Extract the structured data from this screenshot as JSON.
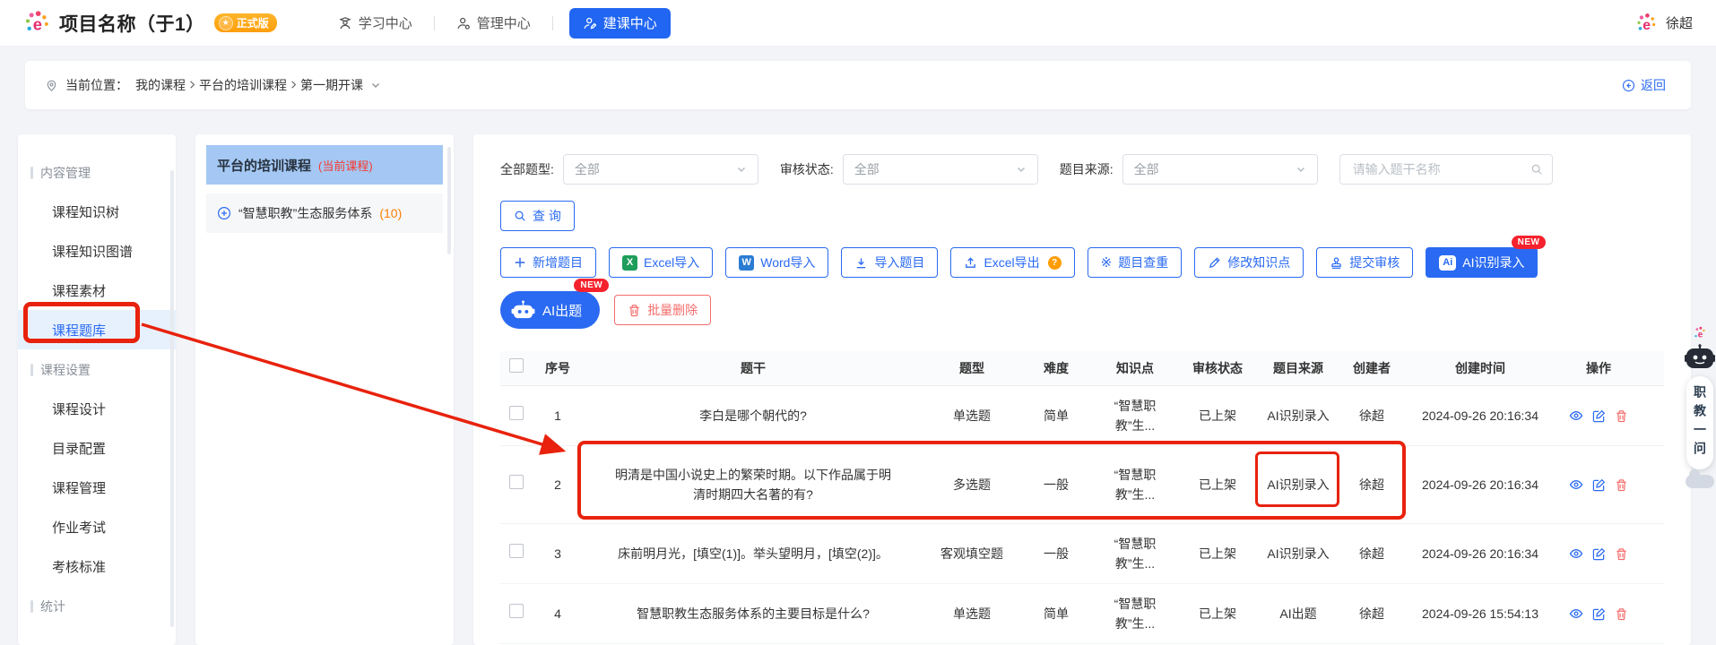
{
  "colors": {
    "accent": "#2a6af2",
    "danger": "#f56c6c",
    "annotation": "#e8220d",
    "badge_orange": "#ff9e0a",
    "count_orange": "#ff7d00",
    "tag_red": "#f5392f",
    "course_highlight": "#a4c8f3"
  },
  "header": {
    "title": "项目名称（于1）",
    "version_badge": "正式版",
    "nav": [
      {
        "id": "learning-center",
        "label": "学习中心",
        "icon": "person-study",
        "active": false
      },
      {
        "id": "admin-center",
        "label": "管理中心",
        "icon": "person-gear",
        "active": false
      },
      {
        "id": "course-building-center",
        "label": "建课中心",
        "icon": "person-edit",
        "active": true
      }
    ],
    "user_name": "徐超"
  },
  "breadcrumb": {
    "prefix": "当前位置：",
    "items": [
      "我的课程",
      "平台的培训课程",
      "第一期开课"
    ],
    "back_label": "返回"
  },
  "sidebar": {
    "sections": [
      {
        "id": "content-management",
        "title": "内容管理",
        "items": [
          {
            "id": "course-knowledge-tree",
            "label": "课程知识树",
            "active": false
          },
          {
            "id": "course-knowledge-graph",
            "label": "课程知识图谱",
            "active": false
          },
          {
            "id": "course-materials",
            "label": "课程素材",
            "active": false
          },
          {
            "id": "course-question-bank",
            "label": "课程题库",
            "active": true
          }
        ]
      },
      {
        "id": "course-settings",
        "title": "课程设置",
        "items": [
          {
            "id": "course-design",
            "label": "课程设计",
            "active": false
          },
          {
            "id": "catalog-config",
            "label": "目录配置",
            "active": false
          },
          {
            "id": "course-management",
            "label": "课程管理",
            "active": false
          },
          {
            "id": "homework-exam",
            "label": "作业考试",
            "active": false
          },
          {
            "id": "assessment-standard",
            "label": "考核标准",
            "active": false
          }
        ]
      },
      {
        "id": "statistics",
        "title": "统计",
        "items": []
      }
    ]
  },
  "course_panel": {
    "current_course": {
      "name": "平台的培训课程",
      "tag": "(当前课程)"
    },
    "tree_item": {
      "label": "“智慧职教”生态服务体系",
      "count": "(10)"
    }
  },
  "filters": {
    "groups": [
      {
        "id": "question-type",
        "label": "全部题型:",
        "value": "全部"
      },
      {
        "id": "audit-status",
        "label": "审核状态:",
        "value": "全部"
      },
      {
        "id": "question-source",
        "label": "题目来源:",
        "value": "全部"
      }
    ],
    "search_placeholder": "请输入题干名称"
  },
  "toolbar": {
    "query_label": "查 询",
    "actions": [
      {
        "id": "add-question",
        "label": "新增题目",
        "icon": "plus",
        "style": "outline"
      },
      {
        "id": "excel-import",
        "label": "Excel导入",
        "icon": "excel",
        "style": "outline"
      },
      {
        "id": "word-import",
        "label": "Word导入",
        "icon": "word",
        "style": "outline"
      },
      {
        "id": "import-questions",
        "label": "导入题目",
        "icon": "download",
        "style": "outline"
      },
      {
        "id": "excel-export",
        "label": "Excel导出",
        "icon": "upload",
        "style": "outline",
        "help": "?"
      },
      {
        "id": "duplicate-check",
        "label": "题目查重",
        "icon": "sparkle",
        "style": "outline"
      },
      {
        "id": "modify-knowledge-point",
        "label": "修改知识点",
        "icon": "pencil",
        "style": "outline"
      },
      {
        "id": "submit-review",
        "label": "提交审核",
        "icon": "stamp",
        "style": "outline"
      },
      {
        "id": "ai-recognition-entry",
        "label": "AI识别录入",
        "icon": "ai-chip",
        "style": "primary",
        "badge": "NEW"
      }
    ],
    "actions_secondary": [
      {
        "id": "ai-generate",
        "label": "AI出题",
        "icon": "robot",
        "style": "primary-pill",
        "badge": "NEW"
      },
      {
        "id": "batch-delete",
        "label": "批量删除",
        "icon": "trash",
        "style": "danger"
      }
    ]
  },
  "table": {
    "headers": [
      "序号",
      "题干",
      "题型",
      "难度",
      "知识点",
      "审核状态",
      "题目来源",
      "创建者",
      "创建时间",
      "操作"
    ],
    "rows": [
      {
        "no": "1",
        "stem": "李白是哪个朝代的?",
        "type": "单选题",
        "difficulty": "简单",
        "knowledge": "“智慧职教”生...",
        "audit": "已上架",
        "source": "AI识别录入",
        "creator": "徐超",
        "created": "2024-09-26 20:16:34"
      },
      {
        "no": "2",
        "stem": "明清是中国小说史上的繁荣时期。以下作品属于明清时期四大名著的有?",
        "type": "多选题",
        "difficulty": "一般",
        "knowledge": "“智慧职教”生...",
        "audit": "已上架",
        "source": "AI识别录入",
        "creator": "徐超",
        "created": "2024-09-26 20:16:34",
        "highlighted": true
      },
      {
        "no": "3",
        "stem": "床前明月光，[填空(1)]。举头望明月，[填空(2)]。",
        "type": "客观填空题",
        "difficulty": "一般",
        "knowledge": "“智慧职教”生...",
        "audit": "已上架",
        "source": "AI识别录入",
        "creator": "徐超",
        "created": "2024-09-26 20:16:34"
      },
      {
        "no": "4",
        "stem": "智慧职教生态服务体系的主要目标是什么?",
        "type": "单选题",
        "difficulty": "简单",
        "knowledge": "“智慧职教”生...",
        "audit": "已上架",
        "source": "AI出题",
        "creator": "徐超",
        "created": "2024-09-26 15:54:13"
      }
    ]
  },
  "assistant": {
    "label": "职教一问"
  }
}
